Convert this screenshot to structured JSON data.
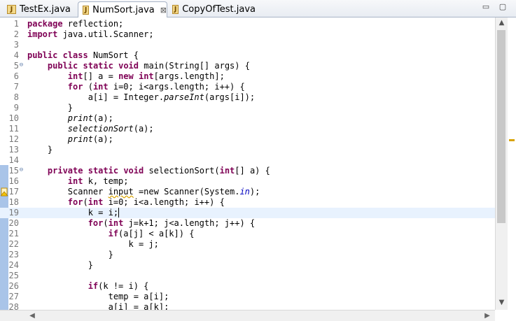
{
  "tabs": [
    {
      "label": "TestEx.java"
    },
    {
      "label": "NumSort.java",
      "close": "⊠"
    },
    {
      "label": "CopyOfTest.java"
    }
  ],
  "window": {
    "minimize": "▭",
    "maximize": "▢"
  },
  "lines": [
    {
      "n": "1"
    },
    {
      "n": "2"
    },
    {
      "n": "3"
    },
    {
      "n": "4"
    },
    {
      "n": "5"
    },
    {
      "n": "6"
    },
    {
      "n": "7"
    },
    {
      "n": "8"
    },
    {
      "n": "9"
    },
    {
      "n": "10"
    },
    {
      "n": "11"
    },
    {
      "n": "12"
    },
    {
      "n": "13"
    },
    {
      "n": "14"
    },
    {
      "n": "15"
    },
    {
      "n": "16"
    },
    {
      "n": "17"
    },
    {
      "n": "18"
    },
    {
      "n": "19"
    },
    {
      "n": "20"
    },
    {
      "n": "21"
    },
    {
      "n": "22"
    },
    {
      "n": "23"
    },
    {
      "n": "24"
    },
    {
      "n": "25"
    },
    {
      "n": "26"
    },
    {
      "n": "27"
    },
    {
      "n": "28"
    }
  ],
  "code": {
    "l1": {
      "kw": "package",
      "rest": " reflection;"
    },
    "l2": {
      "kw": "import",
      "rest": " java.util.Scanner;"
    },
    "l4": {
      "kw1": "public",
      "kw2": "class",
      "rest": " NumSort {"
    },
    "l5": {
      "kw1": "public",
      "kw2": "static",
      "kw3": "void",
      "rest": " main(String[] args) {"
    },
    "l6": {
      "kw1": "int",
      "a": "[] a = ",
      "kw2": "new",
      "b": " ",
      "kw3": "int",
      "c": "[args.length];"
    },
    "l7": {
      "kw": "for",
      "a": " (",
      "kw2": "int",
      "b": " i=0; i<args.length; i++) {"
    },
    "l8": {
      "a": "a[i] = Integer.",
      "it": "parseInt",
      "b": "(args[i]);"
    },
    "l9": "}",
    "l10": {
      "it": "print",
      "b": "(a);"
    },
    "l11": {
      "it": "selectionSort",
      "b": "(a);"
    },
    "l12": {
      "it": "print",
      "b": "(a);"
    },
    "l13": "}",
    "l15": {
      "kw1": "private",
      "kw2": "static",
      "kw3": "void",
      "a": " selectionSort(",
      "kw4": "int",
      "b": "[] a) {"
    },
    "l16": {
      "kw": "int",
      "rest": " k, temp;"
    },
    "l17": {
      "a": "Scanner ",
      "warn": "input",
      "b": " =new Scanner(System.",
      "fld": "in",
      "c": ");"
    },
    "l18": {
      "kw": "for",
      "a": "(",
      "kw2": "int",
      "b": " i=0; i<a.length; i++) {"
    },
    "l19": "k = i;",
    "l20": {
      "kw": "for",
      "a": "(",
      "kw2": "int",
      "b": " j=k+1; j<a.length; j++) {"
    },
    "l21": {
      "kw": "if",
      "rest": "(a[j] < a[k]) {"
    },
    "l22": "k = j;",
    "l23": "}",
    "l24": "}",
    "l26": {
      "kw": "if",
      "rest": "(k != i) {"
    },
    "l27": "temp = a[i];",
    "l28": "a[i] = a[k];"
  },
  "fold_glyph": "⊖",
  "scroll": {
    "up": "▲",
    "down": "▼",
    "left": "◀",
    "right": "▶"
  }
}
